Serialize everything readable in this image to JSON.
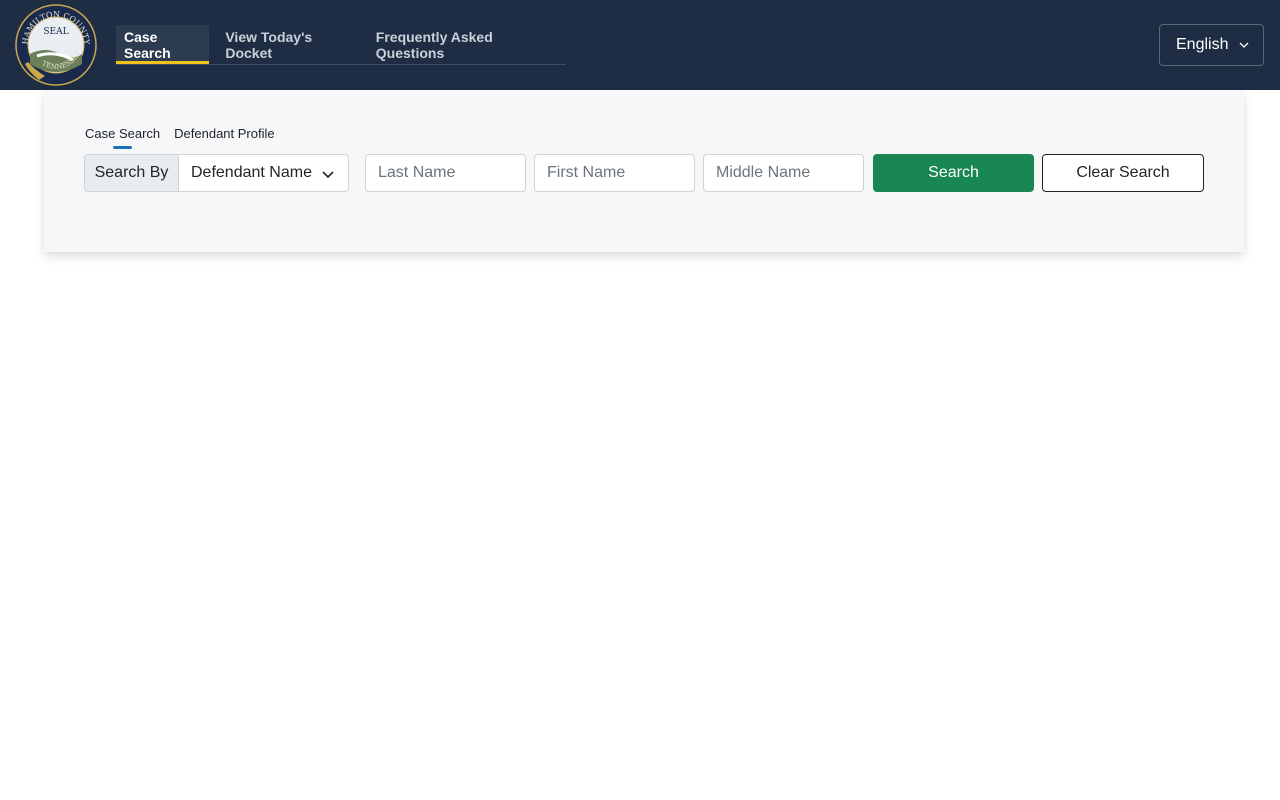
{
  "header": {
    "seal": {
      "text_top": "HAMILTON COUNTY",
      "text_center": "SEAL",
      "text_bottom": "TENNESSEE",
      "colors": {
        "ring": "#1a2a4e",
        "gold": "#c9a94b",
        "sky": "#e9eef3"
      }
    },
    "nav": [
      {
        "label": "Case Search",
        "active": true
      },
      {
        "label": "View Today's Docket",
        "active": false
      },
      {
        "label": "Frequently Asked Questions",
        "active": false
      }
    ],
    "language": {
      "selected": "English",
      "icon": "chevron-down-icon"
    }
  },
  "search_card": {
    "tabs": [
      {
        "label": "Case Search",
        "active": true
      },
      {
        "label": "Defendant Profile",
        "active": false
      }
    ],
    "search_by": {
      "label": "Search By",
      "selected": "Defendant Name",
      "icon": "chevron-down-icon"
    },
    "fields": {
      "last_name": {
        "placeholder": "Last Name",
        "value": ""
      },
      "first_name": {
        "placeholder": "First Name",
        "value": ""
      },
      "middle_name": {
        "placeholder": "Middle Name",
        "value": ""
      }
    },
    "buttons": {
      "search": "Search",
      "clear": "Clear Search"
    }
  },
  "colors": {
    "header_bg": "#1e2d43",
    "active_underline": "#f2c21b",
    "subtab_underline": "#1f6fb6",
    "search_button": "#198754",
    "card_bg": "#f6f7f9"
  }
}
